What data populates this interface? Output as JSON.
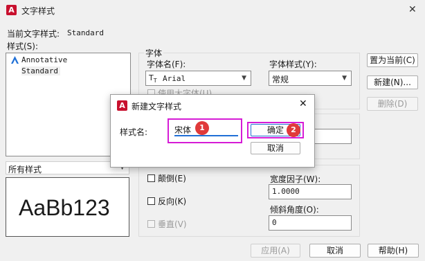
{
  "window": {
    "title": "文字样式",
    "app_icon": "autocad-icon"
  },
  "current_style": {
    "label": "当前文字样式:",
    "value": "Standard"
  },
  "styles": {
    "label": "样式(S):",
    "items": [
      {
        "name": "Annotative",
        "icon": "annotative-icon"
      },
      {
        "name": "Standard"
      }
    ],
    "filter": "所有样式"
  },
  "preview": {
    "sample": "AaBb123"
  },
  "font_group": {
    "title": "字体",
    "font_name_label": "字体名(F):",
    "font_name_value": "Arial",
    "font_icon": "truetype-icon",
    "font_style_label": "字体样式(Y):",
    "font_style_value": "常规",
    "big_font_label": "使用大字体(U)"
  },
  "effects": {
    "upside_down": "颠倒(E)",
    "backwards": "反向(K)",
    "vertical": "垂直(V)",
    "width_factor_label": "宽度因子(W):",
    "width_factor_value": "1.0000",
    "oblique_label": "倾斜角度(O):",
    "oblique_value": "0"
  },
  "side_buttons": {
    "set_current": "置为当前(C)",
    "new": "新建(N)...",
    "delete": "删除(D)"
  },
  "bottom_buttons": {
    "apply": "应用(A)",
    "cancel": "取消",
    "help": "帮助(H)"
  },
  "new_style_dialog": {
    "title": "新建文字样式",
    "name_label": "样式名:",
    "name_value": "宋体",
    "ok": "确定",
    "cancel": "取消",
    "badges": [
      "1",
      "2"
    ],
    "highlight_color": "#d61bd6",
    "badge_color": "#e03a3a"
  },
  "colors": {
    "app_red": "#c8102e",
    "annotative_blue": "#1f6fd6"
  }
}
